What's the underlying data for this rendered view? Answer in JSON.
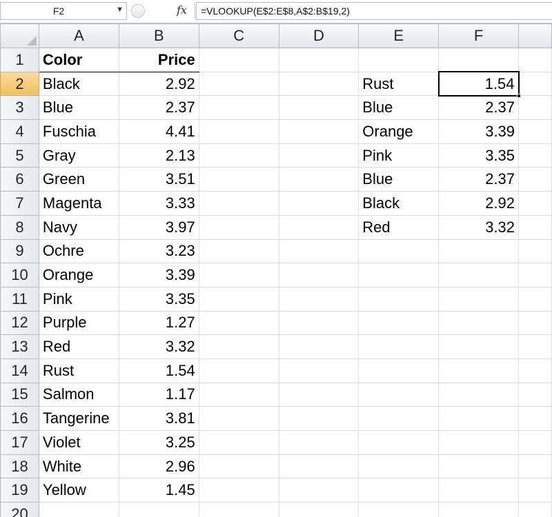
{
  "formula_bar": {
    "name_box": "F2",
    "dropdown_icon": "chevron-down-icon",
    "fx_label": "fx",
    "formula": "=VLOOKUP(E$2:E$8,A$2:B$19,2)"
  },
  "columns": [
    "A",
    "B",
    "C",
    "D",
    "E",
    "F"
  ],
  "selected_column": "F",
  "selected_row": 2,
  "rows": [
    {
      "n": "1",
      "a": "Color",
      "b": "Price",
      "e": "",
      "f": ""
    },
    {
      "n": "2",
      "a": "Black",
      "b": "2.92",
      "e": "Rust",
      "f": "1.54"
    },
    {
      "n": "3",
      "a": "Blue",
      "b": "2.37",
      "e": "Blue",
      "f": "2.37"
    },
    {
      "n": "4",
      "a": "Fuschia",
      "b": "4.41",
      "e": "Orange",
      "f": "3.39"
    },
    {
      "n": "5",
      "a": "Gray",
      "b": "2.13",
      "e": "Pink",
      "f": "3.35"
    },
    {
      "n": "6",
      "a": "Green",
      "b": "3.51",
      "e": "Blue",
      "f": "2.37"
    },
    {
      "n": "7",
      "a": "Magenta",
      "b": "3.33",
      "e": "Black",
      "f": "2.92"
    },
    {
      "n": "8",
      "a": "Navy",
      "b": "3.97",
      "e": "Red",
      "f": "3.32"
    },
    {
      "n": "9",
      "a": "Ochre",
      "b": "3.23",
      "e": "",
      "f": ""
    },
    {
      "n": "10",
      "a": "Orange",
      "b": "3.39",
      "e": "",
      "f": ""
    },
    {
      "n": "11",
      "a": "Pink",
      "b": "3.35",
      "e": "",
      "f": ""
    },
    {
      "n": "12",
      "a": "Purple",
      "b": "1.27",
      "e": "",
      "f": ""
    },
    {
      "n": "13",
      "a": "Red",
      "b": "3.32",
      "e": "",
      "f": ""
    },
    {
      "n": "14",
      "a": "Rust",
      "b": "1.54",
      "e": "",
      "f": ""
    },
    {
      "n": "15",
      "a": "Salmon",
      "b": "1.17",
      "e": "",
      "f": ""
    },
    {
      "n": "16",
      "a": "Tangerine",
      "b": "3.81",
      "e": "",
      "f": ""
    },
    {
      "n": "17",
      "a": "Violet",
      "b": "3.25",
      "e": "",
      "f": ""
    },
    {
      "n": "18",
      "a": "White",
      "b": "2.96",
      "e": "",
      "f": ""
    },
    {
      "n": "19",
      "a": "Yellow",
      "b": "1.45",
      "e": "",
      "f": ""
    },
    {
      "n": "20",
      "a": "",
      "b": "",
      "e": "",
      "f": ""
    }
  ],
  "colors": {
    "header_selected": "#f1c15f",
    "header_bg": "#e3e6eb",
    "gridline": "#dadcdd"
  }
}
